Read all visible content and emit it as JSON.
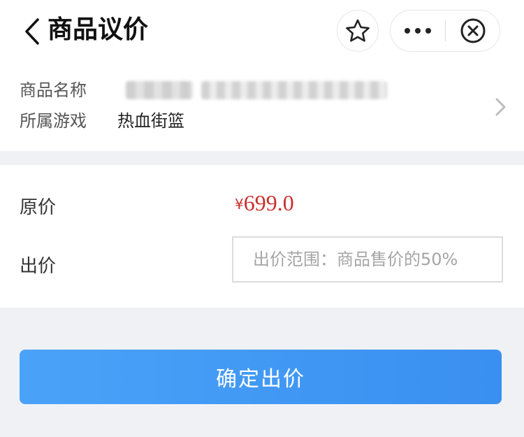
{
  "nav": {
    "title": "商品议价",
    "back_icon": "chevron-left-icon",
    "favorite_icon": "star-icon",
    "more_icon": "more-icon",
    "close_icon": "close-circle-icon"
  },
  "product": {
    "name_label": "商品名称",
    "game_label": "所属游戏",
    "game_value": "热血街篮",
    "chevron_icon": "chevron-right-icon"
  },
  "form": {
    "original_price_label": "原价",
    "currency_symbol": "¥",
    "original_price": "699.0",
    "bid_label": "出价",
    "bid_placeholder": "出价范围：商品售价的50%",
    "bid_value": ""
  },
  "actions": {
    "confirm_label": "确定出价"
  },
  "colors": {
    "price_red": "#c9302c",
    "button_blue": "#3a8ff0"
  }
}
